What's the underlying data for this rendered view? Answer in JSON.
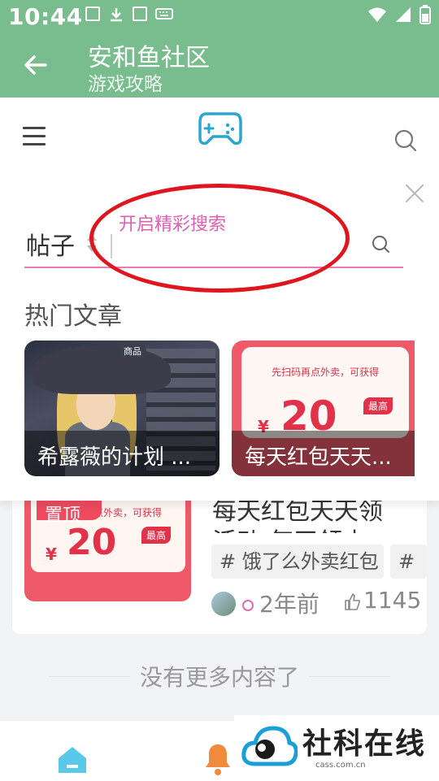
{
  "status_bar": {
    "time": "10:44"
  },
  "app_bar": {
    "title": "安和鱼社区",
    "subtitle": "游戏攻略"
  },
  "search_panel": {
    "scope": "帖子",
    "hint": "开启精彩搜索",
    "input_value": "",
    "hot_title": "热门文章",
    "cards": [
      {
        "caption": "希露薇的计划 ...",
        "tag": "商品"
      },
      {
        "caption": "每天红包天天...",
        "coupon_text": "先扫码再点外卖，可获得",
        "coupon_amount": "20",
        "coupon_yen": "¥",
        "coupon_badge": "最高"
      }
    ]
  },
  "list_item": {
    "pin": "置顶",
    "title_line1": "每天红包天天领",
    "title_line2": "活动:每天领去",
    "tags": [
      "# 饿了么外卖红包",
      "#"
    ],
    "time": "2年前",
    "likes": "1145",
    "image_text": "先扫码再点外卖，可获得",
    "image_amount": "20",
    "image_yen": "¥",
    "image_badge": "最高"
  },
  "footer": {
    "no_more": "没有更多内容了"
  },
  "watermark": {
    "name": "社科在线",
    "url": "cass.com.cn"
  },
  "colors": {
    "appbar": "#79bd8f",
    "accent_pink": "#e97ab8",
    "highlight_ring": "#e0161f"
  }
}
